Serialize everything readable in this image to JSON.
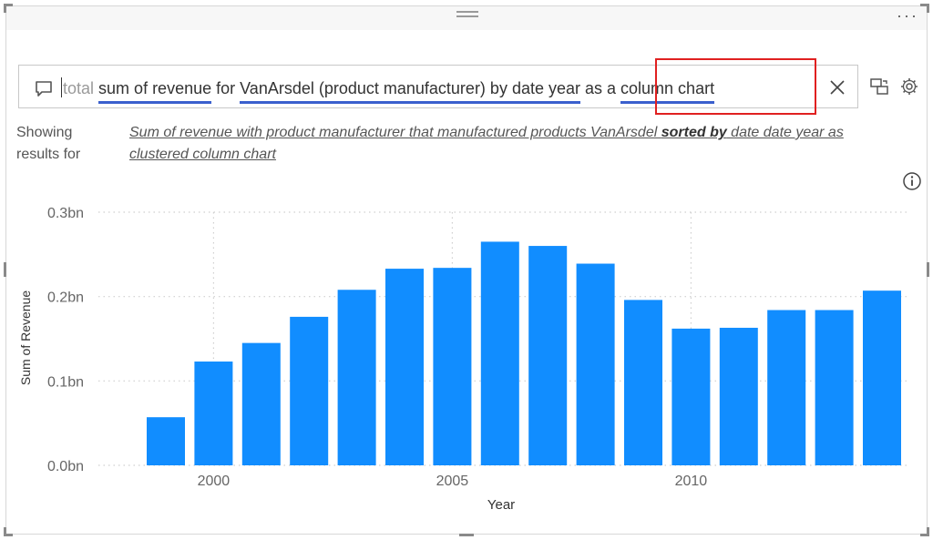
{
  "qa": {
    "faded_prefix": "total",
    "query_part1": "sum of revenue",
    "query_part2": " for ",
    "query_part3": "VanArsdel (product manufacturer) by date year",
    "query_part4": " as a ",
    "query_part5": "column chart"
  },
  "showing": {
    "label_line1": "Showing",
    "label_line2": "results for",
    "restatement_part1": "Sum of revenue with product manufacturer that manufactured products VanArsdel ",
    "restatement_bold": "sorted by",
    "restatement_part2": " date date year as clustered column chart"
  },
  "icons": {
    "chat": "chat-bubble-icon",
    "clear": "close-icon",
    "swap": "swap-visual-icon",
    "settings": "gear-icon",
    "info": "info-icon",
    "more": "ellipsis-icon"
  },
  "chart_data": {
    "type": "bar",
    "xlabel": "Year",
    "ylabel": "Sum of Revenue",
    "x": [
      1999,
      2000,
      2001,
      2002,
      2003,
      2004,
      2005,
      2006,
      2007,
      2008,
      2009,
      2010,
      2011,
      2012,
      2013,
      2014
    ],
    "values": [
      0.057,
      0.123,
      0.145,
      0.176,
      0.208,
      0.233,
      0.234,
      0.265,
      0.26,
      0.239,
      0.196,
      0.162,
      0.163,
      0.184,
      0.184,
      0.207
    ],
    "ylim": [
      0,
      0.3
    ],
    "yticks": [
      0,
      0.1,
      0.2,
      0.3
    ],
    "ytick_labels": [
      "0.0bn",
      "0.1bn",
      "0.2bn",
      "0.3bn"
    ],
    "xticks": [
      2000,
      2005,
      2010
    ],
    "xtick_labels": [
      "2000",
      "2005",
      "2010"
    ],
    "grid": true,
    "bar_color": "#118dff"
  }
}
